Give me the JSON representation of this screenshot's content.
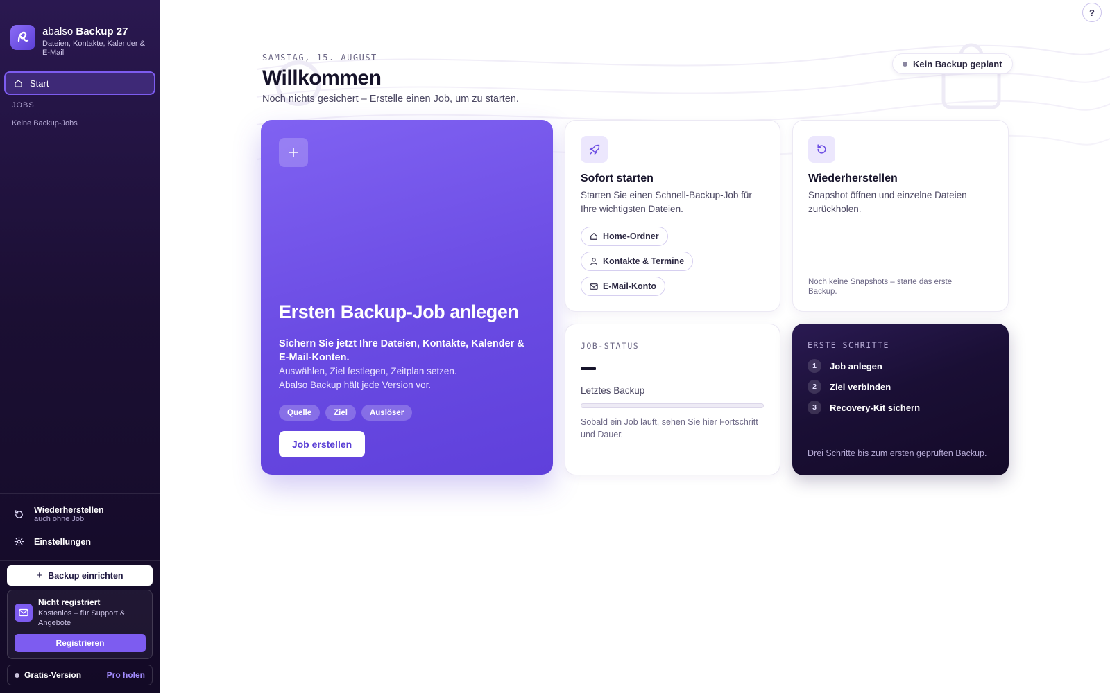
{
  "app": {
    "name_light": "abalso",
    "name_bold": "Backup 27",
    "tagline": "Dateien, Kontakte, Kalender & E-Mail"
  },
  "sidebar": {
    "start_label": "Start",
    "jobs_heading": "JOBS",
    "jobs_empty": "Keine Backup-Jobs",
    "restore_label": "Wiederherstellen",
    "restore_sub": "auch ohne Job",
    "settings_label": "Einstellungen",
    "setup_button": "Backup einrichten",
    "register": {
      "title": "Nicht registriert",
      "subtitle": "Kostenlos – für Support & Angebote",
      "button": "Registrieren"
    },
    "plan": {
      "label": "Gratis-Version",
      "upgrade": "Pro holen"
    }
  },
  "header": {
    "help": "?",
    "date": "SAMSTAG, 15. AUGUST",
    "title": "Willkommen",
    "subtitle": "Noch nichts gesichert – Erstelle einen Job, um zu starten.",
    "status": "Kein Backup geplant"
  },
  "hero": {
    "title": "Ersten Backup-Job anlegen",
    "lead": "Sichern Sie jetzt Ihre Dateien, Kontakte, Kalender & E-Mail-Konten.",
    "line1": "Auswählen, Ziel festlegen, Zeitplan setzen.",
    "line2": "Abalso Backup hält jede Version vor.",
    "tags": [
      "Quelle",
      "Ziel",
      "Auslöser"
    ],
    "button": "Job erstellen"
  },
  "quick_start": {
    "title": "Sofort starten",
    "text": "Starten Sie einen Schnell-Backup-Job für Ihre wichtigsten Dateien.",
    "chips": [
      "Home-Ordner",
      "Kontakte & Termine",
      "E-Mail-Konto"
    ]
  },
  "restore_card": {
    "title": "Wiederherstellen",
    "text": "Snapshot öffnen und einzelne Dateien zurückholen.",
    "note": "Noch keine Snapshots – starte das erste Backup."
  },
  "job_status": {
    "label": "JOB-STATUS",
    "last_label": "Letztes Backup",
    "progress": 0,
    "text": "Sobald ein Job läuft, sehen Sie hier Fortschritt und Dauer."
  },
  "first_steps": {
    "label": "ERSTE SCHRITTE",
    "steps": [
      {
        "num": "1",
        "label": "Job anlegen"
      },
      {
        "num": "2",
        "label": "Ziel verbinden"
      },
      {
        "num": "3",
        "label": "Recovery-Kit sichern"
      }
    ],
    "footer": "Drei Schritte bis zum ersten geprüften Backup."
  },
  "colors": {
    "accent": "#7d5cf0",
    "sidebar_bg": "#1b0f33",
    "hero_bg": "#6a4be3"
  }
}
